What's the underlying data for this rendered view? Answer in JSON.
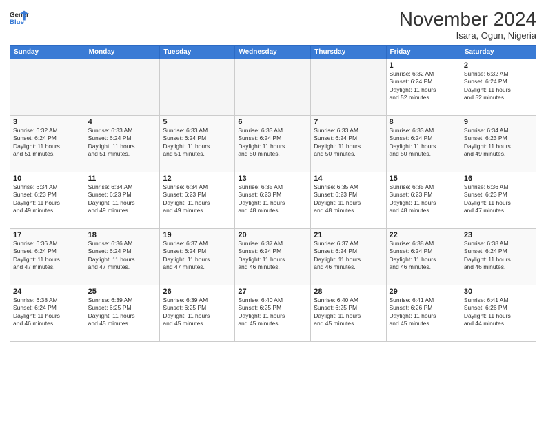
{
  "logo": {
    "line1": "General",
    "line2": "Blue"
  },
  "title": "November 2024",
  "location": "Isara, Ogun, Nigeria",
  "days_of_week": [
    "Sunday",
    "Monday",
    "Tuesday",
    "Wednesday",
    "Thursday",
    "Friday",
    "Saturday"
  ],
  "weeks": [
    [
      {
        "day": "",
        "info": ""
      },
      {
        "day": "",
        "info": ""
      },
      {
        "day": "",
        "info": ""
      },
      {
        "day": "",
        "info": ""
      },
      {
        "day": "",
        "info": ""
      },
      {
        "day": "1",
        "info": "Sunrise: 6:32 AM\nSunset: 6:24 PM\nDaylight: 11 hours\nand 52 minutes."
      },
      {
        "day": "2",
        "info": "Sunrise: 6:32 AM\nSunset: 6:24 PM\nDaylight: 11 hours\nand 52 minutes."
      }
    ],
    [
      {
        "day": "3",
        "info": "Sunrise: 6:32 AM\nSunset: 6:24 PM\nDaylight: 11 hours\nand 51 minutes."
      },
      {
        "day": "4",
        "info": "Sunrise: 6:33 AM\nSunset: 6:24 PM\nDaylight: 11 hours\nand 51 minutes."
      },
      {
        "day": "5",
        "info": "Sunrise: 6:33 AM\nSunset: 6:24 PM\nDaylight: 11 hours\nand 51 minutes."
      },
      {
        "day": "6",
        "info": "Sunrise: 6:33 AM\nSunset: 6:24 PM\nDaylight: 11 hours\nand 50 minutes."
      },
      {
        "day": "7",
        "info": "Sunrise: 6:33 AM\nSunset: 6:24 PM\nDaylight: 11 hours\nand 50 minutes."
      },
      {
        "day": "8",
        "info": "Sunrise: 6:33 AM\nSunset: 6:24 PM\nDaylight: 11 hours\nand 50 minutes."
      },
      {
        "day": "9",
        "info": "Sunrise: 6:34 AM\nSunset: 6:23 PM\nDaylight: 11 hours\nand 49 minutes."
      }
    ],
    [
      {
        "day": "10",
        "info": "Sunrise: 6:34 AM\nSunset: 6:23 PM\nDaylight: 11 hours\nand 49 minutes."
      },
      {
        "day": "11",
        "info": "Sunrise: 6:34 AM\nSunset: 6:23 PM\nDaylight: 11 hours\nand 49 minutes."
      },
      {
        "day": "12",
        "info": "Sunrise: 6:34 AM\nSunset: 6:23 PM\nDaylight: 11 hours\nand 49 minutes."
      },
      {
        "day": "13",
        "info": "Sunrise: 6:35 AM\nSunset: 6:23 PM\nDaylight: 11 hours\nand 48 minutes."
      },
      {
        "day": "14",
        "info": "Sunrise: 6:35 AM\nSunset: 6:23 PM\nDaylight: 11 hours\nand 48 minutes."
      },
      {
        "day": "15",
        "info": "Sunrise: 6:35 AM\nSunset: 6:23 PM\nDaylight: 11 hours\nand 48 minutes."
      },
      {
        "day": "16",
        "info": "Sunrise: 6:36 AM\nSunset: 6:23 PM\nDaylight: 11 hours\nand 47 minutes."
      }
    ],
    [
      {
        "day": "17",
        "info": "Sunrise: 6:36 AM\nSunset: 6:24 PM\nDaylight: 11 hours\nand 47 minutes."
      },
      {
        "day": "18",
        "info": "Sunrise: 6:36 AM\nSunset: 6:24 PM\nDaylight: 11 hours\nand 47 minutes."
      },
      {
        "day": "19",
        "info": "Sunrise: 6:37 AM\nSunset: 6:24 PM\nDaylight: 11 hours\nand 47 minutes."
      },
      {
        "day": "20",
        "info": "Sunrise: 6:37 AM\nSunset: 6:24 PM\nDaylight: 11 hours\nand 46 minutes."
      },
      {
        "day": "21",
        "info": "Sunrise: 6:37 AM\nSunset: 6:24 PM\nDaylight: 11 hours\nand 46 minutes."
      },
      {
        "day": "22",
        "info": "Sunrise: 6:38 AM\nSunset: 6:24 PM\nDaylight: 11 hours\nand 46 minutes."
      },
      {
        "day": "23",
        "info": "Sunrise: 6:38 AM\nSunset: 6:24 PM\nDaylight: 11 hours\nand 46 minutes."
      }
    ],
    [
      {
        "day": "24",
        "info": "Sunrise: 6:38 AM\nSunset: 6:24 PM\nDaylight: 11 hours\nand 46 minutes."
      },
      {
        "day": "25",
        "info": "Sunrise: 6:39 AM\nSunset: 6:25 PM\nDaylight: 11 hours\nand 45 minutes."
      },
      {
        "day": "26",
        "info": "Sunrise: 6:39 AM\nSunset: 6:25 PM\nDaylight: 11 hours\nand 45 minutes."
      },
      {
        "day": "27",
        "info": "Sunrise: 6:40 AM\nSunset: 6:25 PM\nDaylight: 11 hours\nand 45 minutes."
      },
      {
        "day": "28",
        "info": "Sunrise: 6:40 AM\nSunset: 6:25 PM\nDaylight: 11 hours\nand 45 minutes."
      },
      {
        "day": "29",
        "info": "Sunrise: 6:41 AM\nSunset: 6:26 PM\nDaylight: 11 hours\nand 45 minutes."
      },
      {
        "day": "30",
        "info": "Sunrise: 6:41 AM\nSunset: 6:26 PM\nDaylight: 11 hours\nand 44 minutes."
      }
    ]
  ]
}
